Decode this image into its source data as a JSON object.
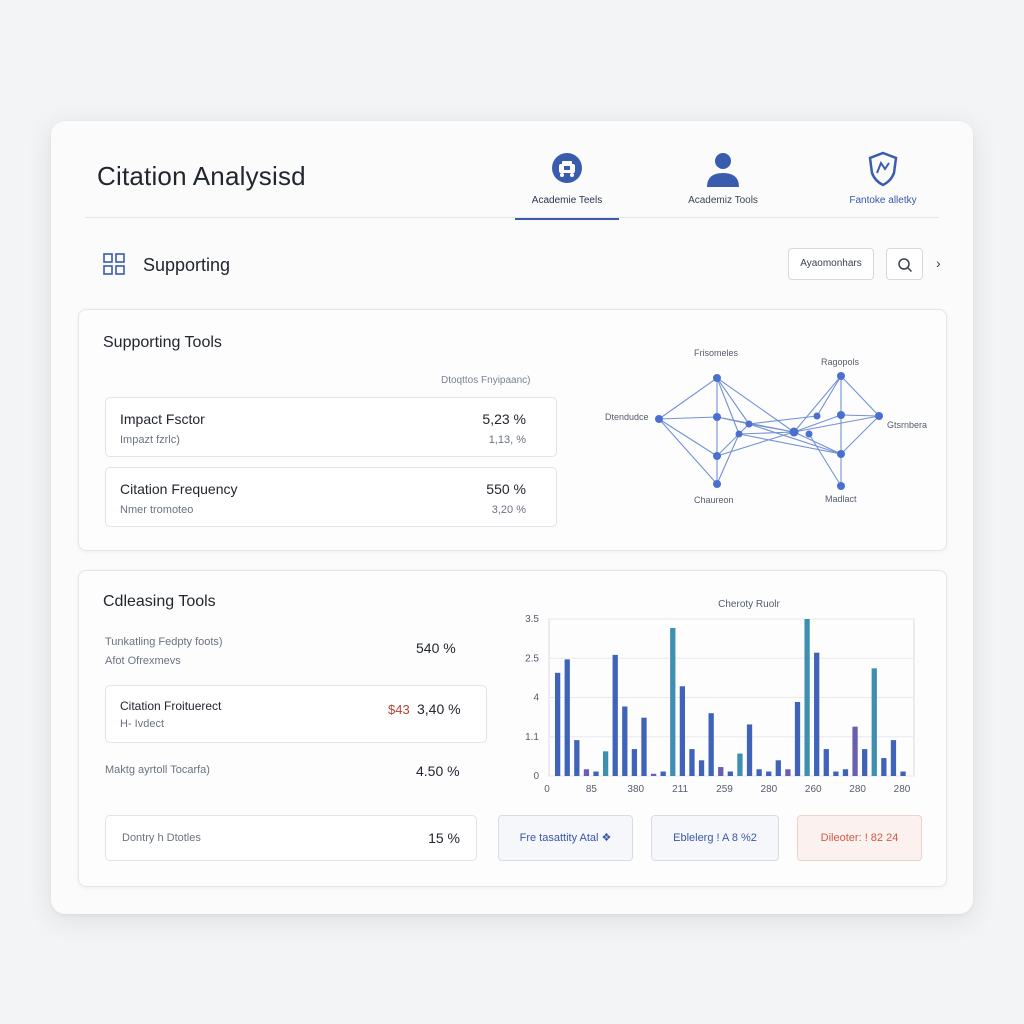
{
  "header": {
    "title": "Citation Analysisd",
    "tabs": [
      {
        "label": "Academie Teels",
        "icon": "tools-icon"
      },
      {
        "label": "Academiz Tools",
        "icon": "user-icon"
      },
      {
        "label": "Fantoke alletky",
        "icon": "shield-icon"
      }
    ]
  },
  "subheader": {
    "title": "Supporting",
    "button_label": "Ayaomonhars",
    "search_icon": "search-icon",
    "chevron": "›"
  },
  "supporting_tools": {
    "title": "Supporting Tools",
    "column_label": "Dtoqttos Fnyipaanc)",
    "metrics": [
      {
        "name": "Impact Fsctor",
        "sub": "Impazt fzrlc)",
        "value": "5,23 %",
        "value2": "1,13, %"
      },
      {
        "name": "Citation Frequency",
        "sub": "Nmer tromoteo",
        "value": "550 %",
        "value2": "3,20 %"
      }
    ]
  },
  "network": {
    "labels": [
      "Frisomeles",
      "Ragopols",
      "Dtendudce",
      "Gtsrnbera",
      "Chaureon",
      "Madlact"
    ]
  },
  "cleansing_tools": {
    "title": "Cdleasing Tools",
    "rows": [
      {
        "label1": "Tunkatling Fedpty foots)",
        "label2": "Afot Ofrexmevs",
        "value": "540 %"
      },
      {
        "label1": "Citation Froituerect",
        "label2": "H- Ivdect",
        "value": "3,40 %",
        "value_prefix": "$43",
        "boxed": true
      },
      {
        "label1": "Maktg ayrtoll Tocarfa)",
        "label2": "",
        "value": "4.50 %"
      }
    ]
  },
  "footer": {
    "card_label": "Dontry h Dtotles",
    "card_value": "15 %",
    "buttons": [
      "Fre tasattity Atal ❖",
      "Eblelerg ! A 8 %2",
      "Dileoter: ! 82 24"
    ]
  },
  "colors": {
    "accent": "#3a5cae",
    "bar": "#3f63b8",
    "bar_alt": "#6a5fae",
    "teal": "#3e8fb0",
    "danger": "#cf5a45"
  },
  "chart_data": {
    "type": "bar",
    "title": "Cheroty Ruolr",
    "yticks": [
      "3.5",
      "2.5",
      "4",
      "1.1",
      "0"
    ],
    "xticks": [
      "0",
      "85",
      "380",
      "211",
      "259",
      "280",
      "260",
      "280",
      "280"
    ],
    "ylim": [
      0,
      3.5
    ],
    "values": [
      2.3,
      2.6,
      0.8,
      0.15,
      0.1,
      0.55,
      2.7,
      1.55,
      0.6,
      1.3,
      0.05,
      0.1,
      3.3,
      2.0,
      0.6,
      0.35,
      1.4,
      0.2,
      0.1,
      0.5,
      1.15,
      0.15,
      0.1,
      0.35,
      0.15,
      1.65,
      3.5,
      2.75,
      0.6,
      0.1,
      0.15,
      1.1,
      0.6,
      2.4,
      0.4,
      0.8,
      0.1
    ],
    "grid": true
  }
}
